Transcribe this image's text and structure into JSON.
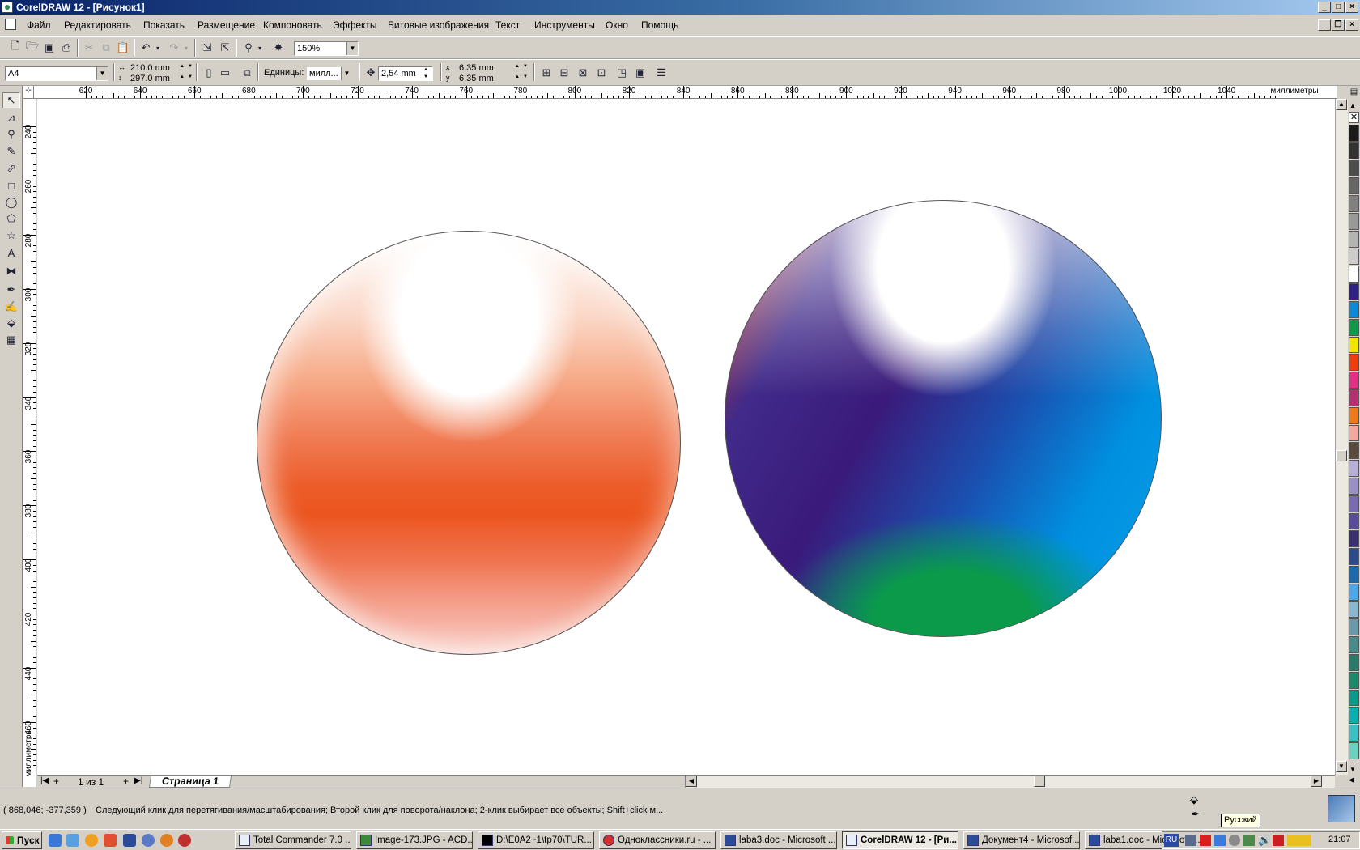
{
  "window": {
    "title": "CorelDRAW 12 - [Рисунок1]"
  },
  "menu": {
    "items": [
      "Файл",
      "Редактировать",
      "Показать",
      "Размещение",
      "Компоновать",
      "Эффекты",
      "Битовые изображения",
      "Текст",
      "Инструменты",
      "Окно",
      "Помощь"
    ]
  },
  "standard_toolbar": {
    "zoom": "150%"
  },
  "property_bar": {
    "page_size": "A4",
    "width": "210.0 mm",
    "height": "297.0 mm",
    "units_label": "Единицы:",
    "units_value": "милл...",
    "nudge": "2,54 mm",
    "dup_x": "6.35 mm",
    "dup_y": "6.35 mm"
  },
  "rulers": {
    "horizontal_labels": [
      "620",
      "640",
      "660",
      "680",
      "700",
      "720",
      "740",
      "760",
      "780",
      "800",
      "820",
      "840",
      "860",
      "880",
      "900",
      "920",
      "940",
      "960",
      "980",
      "1000",
      "1020",
      "1040"
    ],
    "unit_label": "миллиметры",
    "vertical_labels": [
      "240",
      "260",
      "280",
      "300",
      "320",
      "340",
      "360",
      "380",
      "400",
      "420",
      "440",
      "460"
    ]
  },
  "page_tabs": {
    "counter": "1 из 1",
    "tab": "Страница 1"
  },
  "status": {
    "coords": "( 868,046; -377,359 )",
    "message": "Следующий клик для перетягивания/масштабирования; Второй клик для поворота/наклона; 2-клик выбирает все объекты; Shift+click м..."
  },
  "taskbar": {
    "start": "Пуск",
    "buttons": [
      "Total Commander 7.0 ...",
      "Image-173.JPG - ACD...",
      "D:\\E0A2~1\\tp70\\TUR...",
      "Одноклассники.ru - ...",
      "laba3.doc - Microsoft ...",
      "CorelDRAW 12 - [Ри...",
      "Документ4 - Microsof...",
      "laba1.doc - Microsoft ..."
    ],
    "lang": "RU",
    "lang_tooltip": "Русский",
    "clock": "21:07"
  },
  "colors": {
    "palette": [
      "#1a1a1a",
      "#333333",
      "#4d4d4d",
      "#666666",
      "#808080",
      "#999999",
      "#b3b3b3",
      "#cccccc",
      "#ffffff",
      "#2e2288",
      "#0c8ad8",
      "#0e9a4a",
      "#f2e600",
      "#ee3e10",
      "#e22e84",
      "#b43070",
      "#f07a1a",
      "#f4a6a0",
      "#5a4a3a",
      "#b8b0d8",
      "#9a90c4",
      "#7a6ab0",
      "#5a4a9a",
      "#3a3070",
      "#2a4a8a",
      "#1a6ab0",
      "#4aa8e8",
      "#8ab8d0",
      "#6a9aaa",
      "#4a8a8a",
      "#2a7a6a",
      "#1a8a6a",
      "#0a9a8a",
      "#0ab0b0",
      "#3ac0c0",
      "#6ad0c0"
    ]
  }
}
